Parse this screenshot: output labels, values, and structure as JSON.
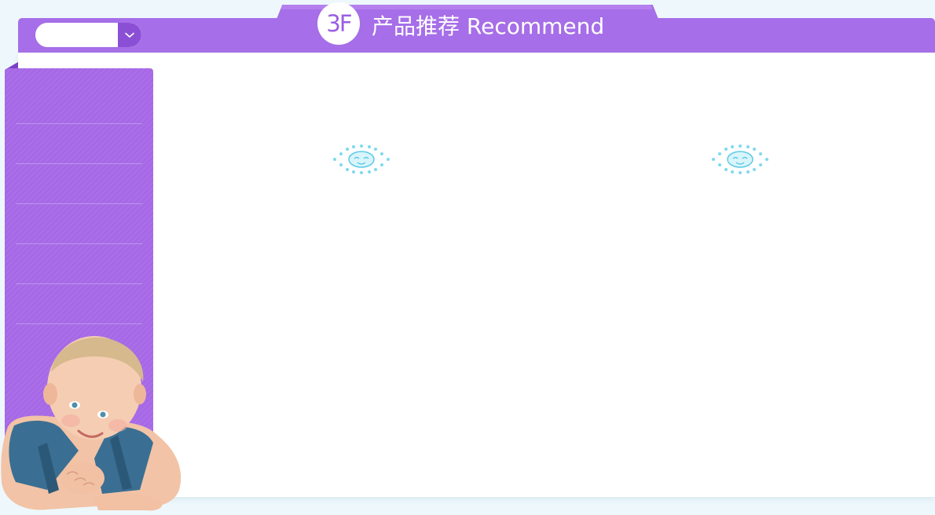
{
  "header": {
    "floor_badge": "3F",
    "title": "产品推荐 Recommend",
    "accent_color": "#a66ee8"
  },
  "selector": {
    "value": "",
    "icon": "chevron-down-icon"
  },
  "sidebar": {
    "items": [
      {
        "label": ""
      },
      {
        "label": ""
      },
      {
        "label": ""
      },
      {
        "label": ""
      },
      {
        "label": ""
      },
      {
        "label": ""
      }
    ]
  },
  "products": [
    {
      "status_icon": "loading-icon"
    },
    {
      "status_icon": "loading-icon"
    }
  ],
  "decor": {
    "mascot": "baby-illustration"
  }
}
